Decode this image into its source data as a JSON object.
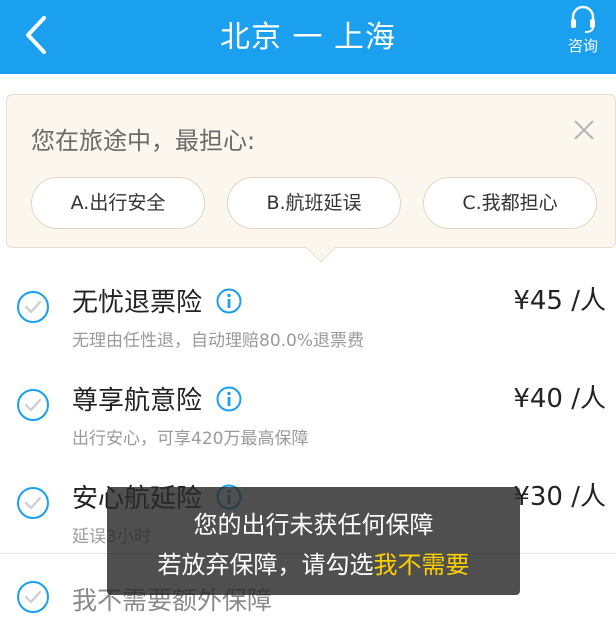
{
  "header": {
    "title": "北京 一 上海",
    "consult_label": "咨询"
  },
  "survey": {
    "question": "您在旅途中，最担心:",
    "options": [
      {
        "label": "A.出行安全"
      },
      {
        "label": "B.航班延误"
      },
      {
        "label": "C.我都担心"
      }
    ]
  },
  "insurance": [
    {
      "name": "无忧退票险",
      "price": "¥45 /人",
      "desc": "无理由任性退，自动理赔80.0%退票费"
    },
    {
      "name": "尊享航意险",
      "price": "¥40 /人",
      "desc": "出行安心，可享420万最高保障"
    },
    {
      "name": "安心航延险",
      "price": "¥30 /人",
      "desc": "延误3小时"
    }
  ],
  "decline": {
    "label": "我不需要额外保障"
  },
  "toast": {
    "line1": "您的出行未获任何保障",
    "line2_prefix": "若放弃保障，请勾选",
    "line2_highlight": "我不需要"
  },
  "colors": {
    "header_bg": "#1aa0ee",
    "accent": "#1aa0ee",
    "highlight": "#ffd000"
  }
}
